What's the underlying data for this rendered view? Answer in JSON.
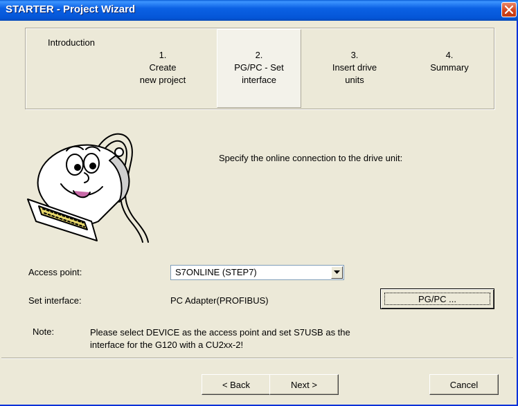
{
  "window": {
    "title": "STARTER - Project Wizard"
  },
  "steps": [
    {
      "line1": "",
      "line2": "Introduction",
      "line3": ""
    },
    {
      "line1": "1.",
      "line2": "Create",
      "line3": "new project"
    },
    {
      "line1": "2.",
      "line2": "PG/PC - Set",
      "line3": "interface"
    },
    {
      "line1": "3.",
      "line2": "Insert drive",
      "line3": "units"
    },
    {
      "line1": "4.",
      "line2": "Summary",
      "line3": ""
    }
  ],
  "active_step": 2,
  "instruction": "Specify the online connection to the drive unit:",
  "access_point": {
    "label": "Access point:",
    "value": "S7ONLINE (STEP7)"
  },
  "set_interface": {
    "label": "Set interface:",
    "value": "PC Adapter(PROFIBUS)",
    "button": "PG/PC ..."
  },
  "note": {
    "label": "Note:",
    "line1": "Please select DEVICE as the access point and set S7USB as the",
    "line2": "interface for the G120 with a CU2xx-2!"
  },
  "buttons": {
    "back": "< Back",
    "next": "Next >",
    "cancel": "Cancel"
  },
  "icons": {
    "close": "close-icon",
    "dropdown": "chevron-down-icon",
    "mascot": "cable-connector-mascot"
  },
  "colors": {
    "titlebar": "#0455d6",
    "close": "#d3461e",
    "dialog": "#ece9d8"
  }
}
